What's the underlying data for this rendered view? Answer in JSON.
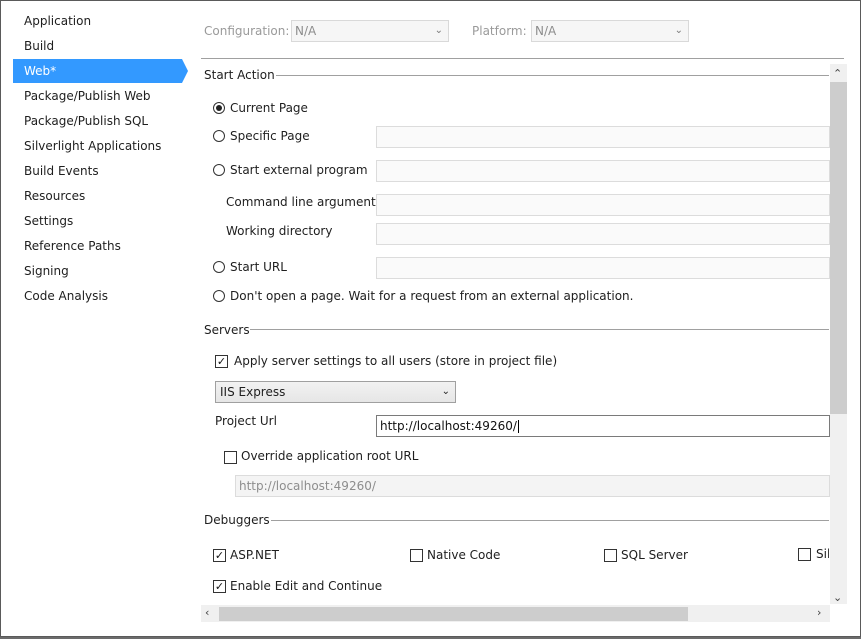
{
  "sidebar": {
    "items": [
      {
        "label": "Application"
      },
      {
        "label": "Build"
      },
      {
        "label": "Web*",
        "active": true
      },
      {
        "label": "Package/Publish Web"
      },
      {
        "label": "Package/Publish SQL"
      },
      {
        "label": "Silverlight Applications"
      },
      {
        "label": "Build Events"
      },
      {
        "label": "Resources"
      },
      {
        "label": "Settings"
      },
      {
        "label": "Reference Paths"
      },
      {
        "label": "Signing"
      },
      {
        "label": "Code Analysis"
      }
    ]
  },
  "toolbar": {
    "configuration_label": "Configuration:",
    "configuration_value": "N/A",
    "platform_label": "Platform:",
    "platform_value": "N/A"
  },
  "start_action": {
    "title": "Start Action",
    "current_page": "Current Page",
    "specific_page": "Specific Page",
    "external_program": "Start external program",
    "command_line_args": "Command line arguments",
    "working_directory": "Working directory",
    "start_url": "Start URL",
    "dont_open": "Don't open a page.  Wait for a request from an external application."
  },
  "servers": {
    "title": "Servers",
    "apply_settings": "Apply server settings to all users (store in project file)",
    "server_value": "IIS Express",
    "project_url_label": "Project Url",
    "project_url_value": "http://localhost:49260/",
    "override_root": "Override application root URL",
    "root_url_value": "http://localhost:49260/"
  },
  "debuggers": {
    "title": "Debuggers",
    "aspnet": "ASP.NET",
    "native_code": "Native Code",
    "sql_server": "SQL Server",
    "silverlight": "Sil",
    "edit_continue": "Enable Edit and Continue"
  },
  "colors": {
    "accent": "#3399ff"
  }
}
